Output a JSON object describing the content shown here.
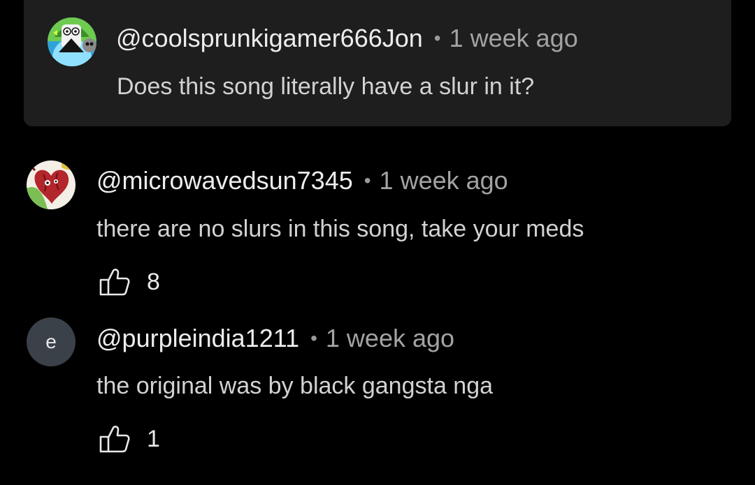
{
  "colors": {
    "page_background": "#000000",
    "parent_card_background": "#1e1e1e",
    "letter_avatar_background": "#3b4149",
    "timestamp_text": "#a3a3a3"
  },
  "parent_comment": {
    "avatar_icon": "cartoon-character-avatar-icon",
    "username": "@coolsprunkigamer666Jon",
    "separator": "•",
    "timestamp": "1 week ago",
    "text": "Does this song literally have a slur in it?"
  },
  "replies": [
    {
      "avatar_icon": "cartoon-heart-avatar-icon",
      "username": "@microwavedsun7345",
      "separator": "•",
      "timestamp": "1 week ago",
      "text": "there are no slurs in this song, take your meds",
      "like_icon": "thumbs-up-icon",
      "likes": "8"
    },
    {
      "avatar_letter": "e",
      "username": "@purpleindia1211",
      "separator": "•",
      "timestamp": "1 week ago",
      "text": "the original was by black gangsta nga",
      "like_icon": "thumbs-up-icon",
      "likes": "1"
    }
  ]
}
